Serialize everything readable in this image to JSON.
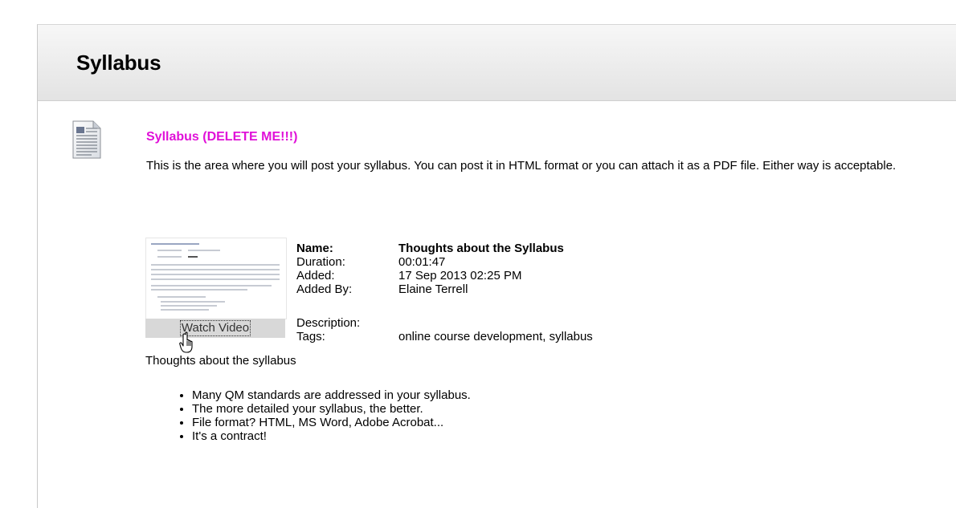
{
  "page": {
    "title": "Syllabus"
  },
  "item": {
    "title": "Syllabus (DELETE ME!!!)",
    "title_color": "#e010d8",
    "description": "This is the area where you will post your syllabus. You can post it in HTML format or you can attach it as a PDF file. Either way is acceptable."
  },
  "video": {
    "watch_label": "Watch Video",
    "name_label": "Name:",
    "name_value": "Thoughts about the Syllabus",
    "duration_label": "Duration:",
    "duration_value": "00:01:47",
    "added_label": "Added:",
    "added_value": "17 Sep 2013 02:25 PM",
    "added_by_label": "Added By:",
    "added_by_value": "Elaine Terrell",
    "description_label": "Description:",
    "description_value": "",
    "tags_label": "Tags:",
    "tags_value": "online course development, syllabus",
    "caption": "Thoughts about the syllabus"
  },
  "bullets": [
    "Many QM standards are addressed in your syllabus.",
    "The more detailed your syllabus, the better.",
    "File format? HTML, MS Word, Adobe Acrobat...",
    "It's a contract!"
  ],
  "icons": {
    "document": "document-icon",
    "cursor": "hand-pointer-icon",
    "thumbnail": "video-thumbnail"
  }
}
